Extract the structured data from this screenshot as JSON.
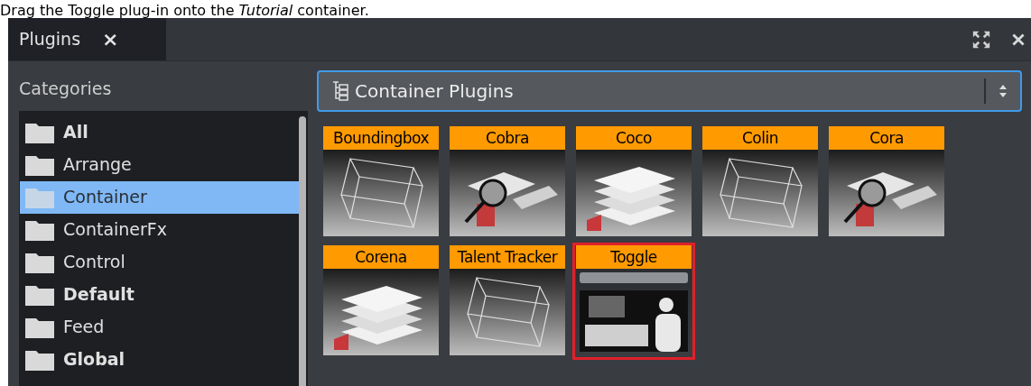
{
  "instruction": "Drag the Toggle plug-in onto the *Tutorial* container.",
  "tabs": [
    {
      "label": "Plugins",
      "close": "×",
      "selected": true
    }
  ],
  "categories_label": "Categories",
  "categories": [
    {
      "label": "All",
      "bold": true,
      "selected": false
    },
    {
      "label": "Arrange",
      "bold": false,
      "selected": false
    },
    {
      "label": "Container",
      "bold": false,
      "selected": true
    },
    {
      "label": "ContainerFx",
      "bold": false,
      "selected": false
    },
    {
      "label": "Control",
      "bold": false,
      "selected": false
    },
    {
      "label": "Default",
      "bold": true,
      "selected": false
    },
    {
      "label": "Feed",
      "bold": false,
      "selected": false
    },
    {
      "label": "Global",
      "bold": true,
      "selected": false
    }
  ],
  "dropdown": {
    "value": "Container Plugins"
  },
  "plugins": [
    {
      "name": "Boundingbox",
      "selected": false
    },
    {
      "name": "Cobra",
      "selected": false
    },
    {
      "name": "Coco",
      "selected": false
    },
    {
      "name": "Colin",
      "selected": false
    },
    {
      "name": "Cora",
      "selected": false
    },
    {
      "name": "Corena",
      "selected": false
    },
    {
      "name": "Talent Tracker",
      "selected": false
    },
    {
      "name": "Toggle",
      "selected": true
    }
  ]
}
